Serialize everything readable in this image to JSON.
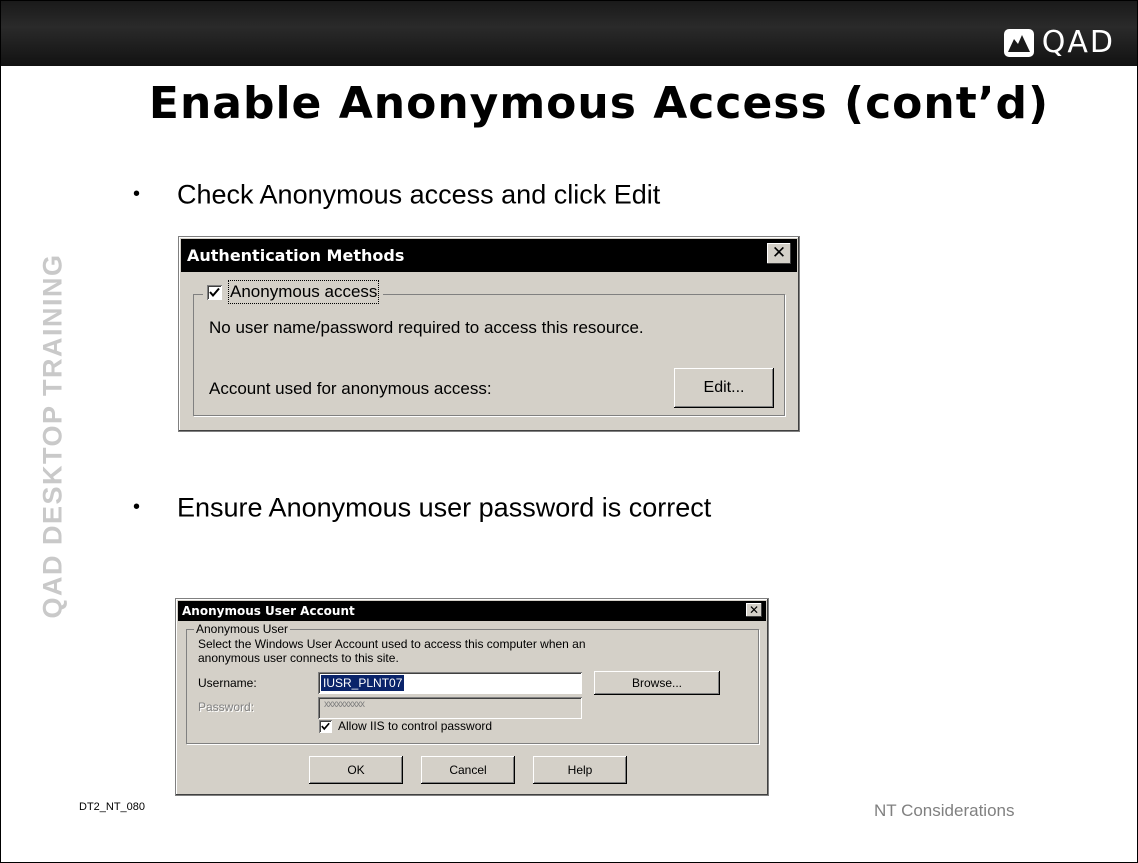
{
  "logo": {
    "text": "QAD"
  },
  "slide": {
    "title": "Enable Anonymous Access (cont’d)",
    "side_label": "QAD DESKTOP TRAINING",
    "bullets": [
      "Check Anonymous access and click Edit",
      "Ensure Anonymous user password is correct"
    ],
    "bullet_glyph": "•",
    "footer_left": "DT2_NT_080",
    "footer_right": "NT Considerations"
  },
  "auth_dialog": {
    "title": "Authentication Methods",
    "close_glyph": "✕",
    "anonymous_checkbox": {
      "label": "Anonymous access",
      "checked": true
    },
    "description": "No user name/password required to access this resource.",
    "account_label": "Account used for anonymous access:",
    "edit_button": "Edit..."
  },
  "anon_dialog": {
    "title": "Anonymous User Account",
    "close_glyph": "✕",
    "group_label": "Anonymous User",
    "description_line1": "Select the Windows User Account used to access this computer when an",
    "description_line2": "anonymous user connects to this site.",
    "username_label": "Username:",
    "username_value": "IUSR_PLNT07",
    "browse_button": "Browse...",
    "password_label": "Password:",
    "password_value": "xxxxxxxxxx",
    "allow_iis_checkbox": {
      "label": "Allow IIS to control password",
      "checked": true
    },
    "ok_button": "OK",
    "cancel_button": "Cancel",
    "help_button": "Help"
  },
  "colors": {
    "topbar": "#1a1a1a",
    "dialog_face": "#d4d0c8",
    "titlebar": "#000000",
    "selection": "#0a246a",
    "side_label": "#c9c9c9"
  }
}
